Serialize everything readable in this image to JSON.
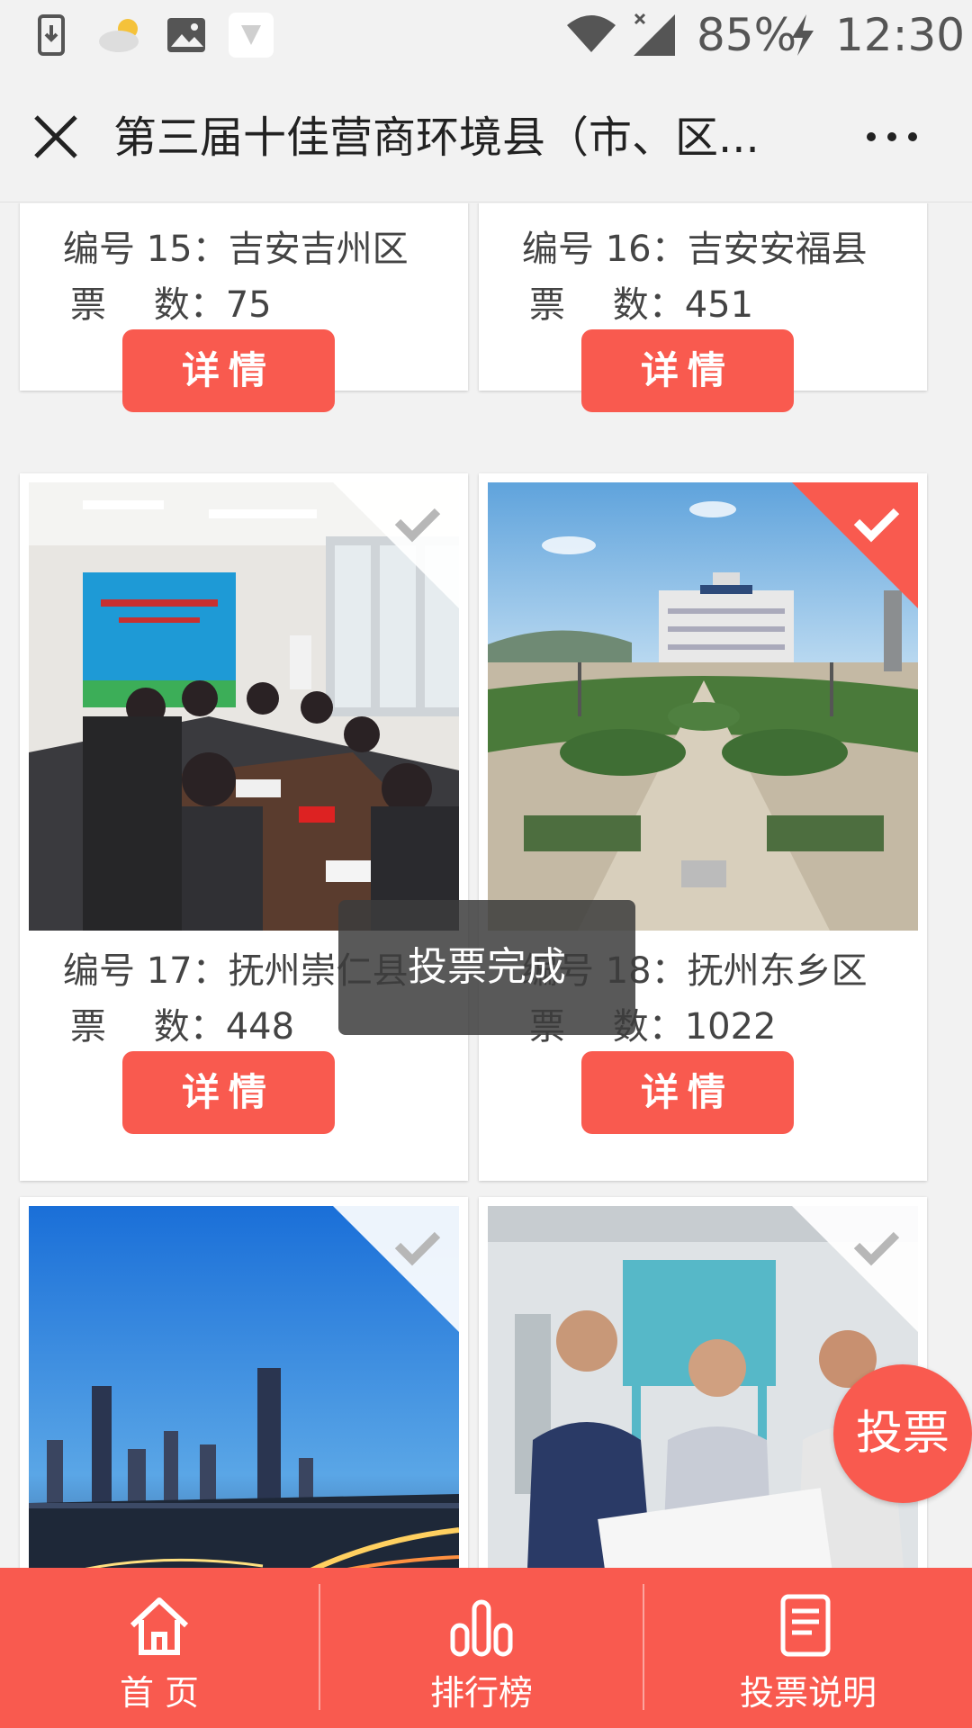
{
  "status_bar": {
    "battery": "85%",
    "time": "12:30"
  },
  "header": {
    "title": "第三届十佳营商环境县（市、区..."
  },
  "cards": [
    {
      "number_label": "编号 15：吉安吉州区",
      "votes_label": "票　 数：75",
      "button": "详情",
      "voted": false
    },
    {
      "number_label": "编号 16：吉安安福县",
      "votes_label": "票　 数：451",
      "button": "详情",
      "voted": false
    },
    {
      "number_label": "编号 17：抚州崇仁县",
      "votes_label": "票　 数：448",
      "button": "详情",
      "voted": false
    },
    {
      "number_label": "编号 18：抚州东乡区",
      "votes_label": "票　 数：1022",
      "button": "详情",
      "voted": true
    },
    {
      "voted": false
    },
    {
      "voted": false
    }
  ],
  "toast": "投票完成",
  "fab_label": "投票",
  "bottom_nav": [
    {
      "label": "首 页",
      "icon": "home-icon"
    },
    {
      "label": "排行榜",
      "icon": "bar-chart-icon"
    },
    {
      "label": "投票说明",
      "icon": "document-icon"
    }
  ],
  "colors": {
    "accent": "#f95a4f",
    "background": "#f2f2f2"
  }
}
